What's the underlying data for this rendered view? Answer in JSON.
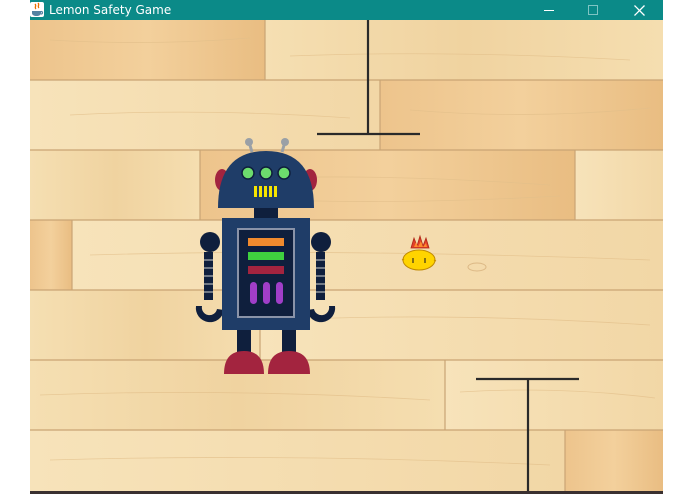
{
  "window": {
    "title": "Lemon Safety Game",
    "controls": {
      "minimize": "minimize",
      "maximize": "maximize",
      "close": "close"
    }
  },
  "colors": {
    "titlebar": "#0b8a88",
    "wood_light": "#f3dcae",
    "wood_mid": "#ecc78f",
    "plank_seam": "#c9a474",
    "robot_navy": "#1f3d68",
    "robot_dark": "#0f1f3d",
    "robot_crimson": "#a3243f",
    "lemon": "#ffd400",
    "flame": "#e0402a"
  },
  "game": {
    "sprites": {
      "player": "robot",
      "collectible": "lemon-with-flames"
    },
    "obstacles": [
      "t-barrier-top",
      "t-barrier-bottom"
    ]
  }
}
